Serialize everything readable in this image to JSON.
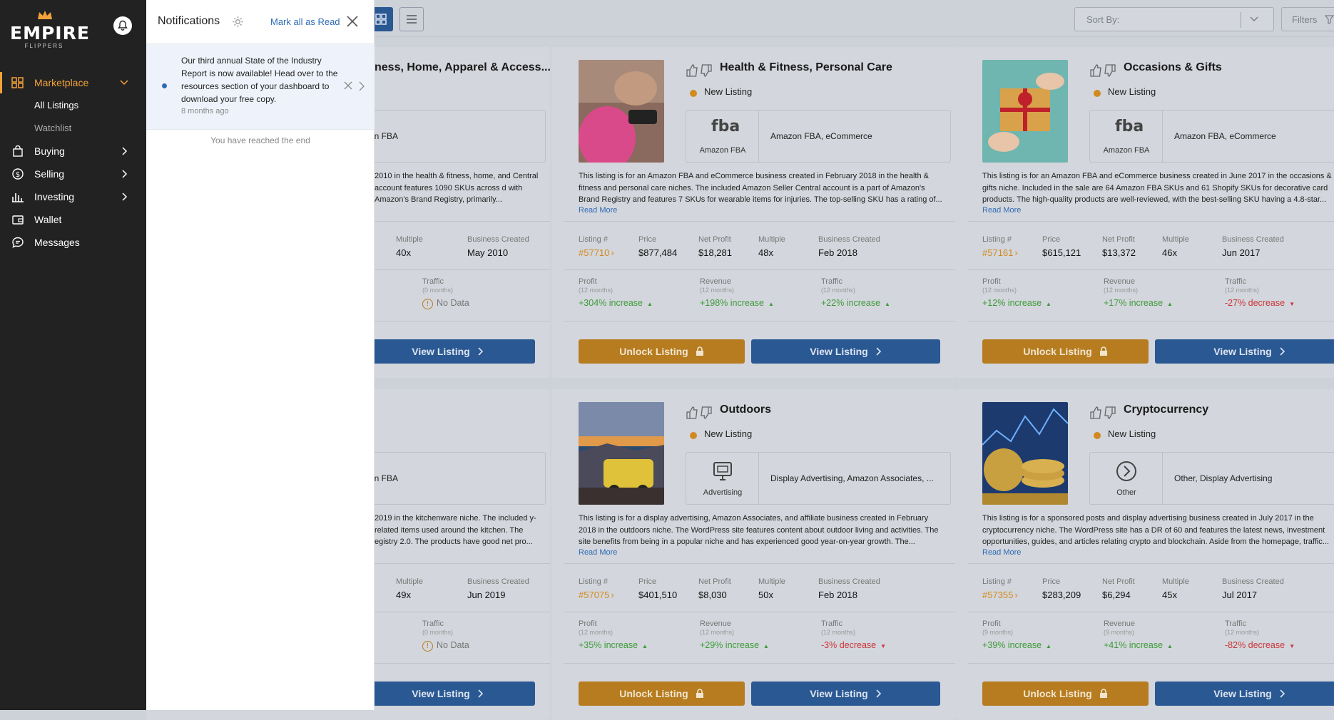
{
  "sidebar": {
    "logo": {
      "word": "EMPIRE",
      "sub": "FLIPPERS"
    },
    "nav": [
      {
        "label": "Marketplace"
      },
      {
        "label": "All Listings"
      },
      {
        "label": "Watchlist"
      },
      {
        "label": "Buying"
      },
      {
        "label": "Selling"
      },
      {
        "label": "Investing"
      },
      {
        "label": "Wallet"
      },
      {
        "label": "Messages"
      }
    ]
  },
  "notifications": {
    "title": "Notifications",
    "mark_all": "Mark all as Read",
    "item": {
      "text": "Our third annual State of the Industry Report is now available! Head over to the resources section of your dashboard to download your free copy.",
      "time": "8 months ago"
    },
    "end": "You have reached the end"
  },
  "toolbar": {
    "sort_placeholder": "Sort By:",
    "filters": "Filters"
  },
  "labels": {
    "new_listing": "New Listing",
    "read_more": "Read More",
    "listing_no": "Listing #",
    "price": "Price",
    "net_profit": "Net Profit",
    "multiple": "Multiple",
    "business_created": "Business Created",
    "profit": "Profit",
    "revenue": "Revenue",
    "traffic": "Traffic",
    "unlock": "Unlock Listing",
    "view": "View Listing"
  },
  "cards": [
    {
      "title": "ness, Home, Apparel & Access...",
      "monetization_text": "zon FBA",
      "desc": "2010 in the health & fitness, home, and Central account features 1090 SKUs across d with Amazon's Brand Registry, primarily...",
      "multiple": "40x",
      "created": "May 2010",
      "traffic_period": "(0 months)",
      "traffic": "No Data"
    },
    {
      "title": "Health & Fitness, Personal Care",
      "icon_label": "Amazon FBA",
      "monetization_text": "Amazon FBA, eCommerce",
      "desc": "This listing is for an Amazon FBA and eCommerce business created in February 2018 in the health & fitness and personal care niches. The included Amazon Seller Central account is a part of Amazon's Brand Registry and features 7 SKUs for wearable items for injuries. The top-selling SKU has a rating of...",
      "listing": "#57710",
      "price": "$877,484",
      "net_profit": "$18,281",
      "multiple": "48x",
      "created": "Feb 2018",
      "profit_period": "(12 months)",
      "profit": "+304% increase",
      "revenue_period": "(12 months)",
      "revenue": "+198% increase",
      "traffic_period": "(12 months)",
      "traffic": "+22% increase"
    },
    {
      "title": "Occasions & Gifts",
      "icon_label": "Amazon FBA",
      "monetization_text": "Amazon FBA, eCommerce",
      "desc": "This listing is for an Amazon FBA and eCommerce business created in June 2017 in the occasions & gifts niche. Included in the sale are 64 Amazon FBA SKUs and 61 Shopify SKUs for decorative card products. The high-quality products are well-reviewed, with the best-selling SKU having a 4.8-star...",
      "listing": "#57161",
      "price": "$615,121",
      "net_profit": "$13,372",
      "multiple": "46x",
      "created": "Jun 2017",
      "profit_period": "(12 months)",
      "profit": "+12% increase",
      "revenue_period": "(12 months)",
      "revenue": "+17% increase",
      "traffic_period": "(12 months)",
      "traffic": "-27% decrease"
    },
    {
      "title": "",
      "monetization_text": "zon FBA",
      "desc": "2019 in the kitchenware niche. The included y-related items used around the kitchen. The egistry 2.0. The products have good net pro...",
      "multiple": "49x",
      "created": "Jun 2019",
      "traffic_period": "(0 months)",
      "traffic": "No Data"
    },
    {
      "title": "Outdoors",
      "icon_label": "Advertising",
      "monetization_text": "Display Advertising, Amazon Associates, ...",
      "desc": "This listing is for a display advertising, Amazon Associates, and affiliate business created in February 2018 in the outdoors niche. The WordPress site features content about outdoor living and activities. The site benefits from being in a popular niche and has experienced good year-on-year growth. The...",
      "listing": "#57075",
      "price": "$401,510",
      "net_profit": "$8,030",
      "multiple": "50x",
      "created": "Feb 2018",
      "profit_period": "(12 months)",
      "profit": "+35% increase",
      "revenue_period": "(12 months)",
      "revenue": "+29% increase",
      "traffic_period": "(12 months)",
      "traffic": "-3% decrease"
    },
    {
      "title": "Cryptocurrency",
      "icon_label": "Other",
      "monetization_text": "Other, Display Advertising",
      "desc": "This listing is for a sponsored posts and display advertising business created in July 2017 in the cryptocurrency niche. The WordPress site has a DR of 60 and features the latest news, investment opportunities, guides, and articles relating crypto and blockchain. Aside from the homepage, traffic...",
      "listing": "#57355",
      "price": "$283,209",
      "net_profit": "$6,294",
      "multiple": "45x",
      "created": "Jul 2017",
      "profit_period": "(9 months)",
      "profit": "+39% increase",
      "revenue_period": "(9 months)",
      "revenue": "+41% increase",
      "traffic_period": "(12 months)",
      "traffic": "-82% decrease"
    }
  ]
}
